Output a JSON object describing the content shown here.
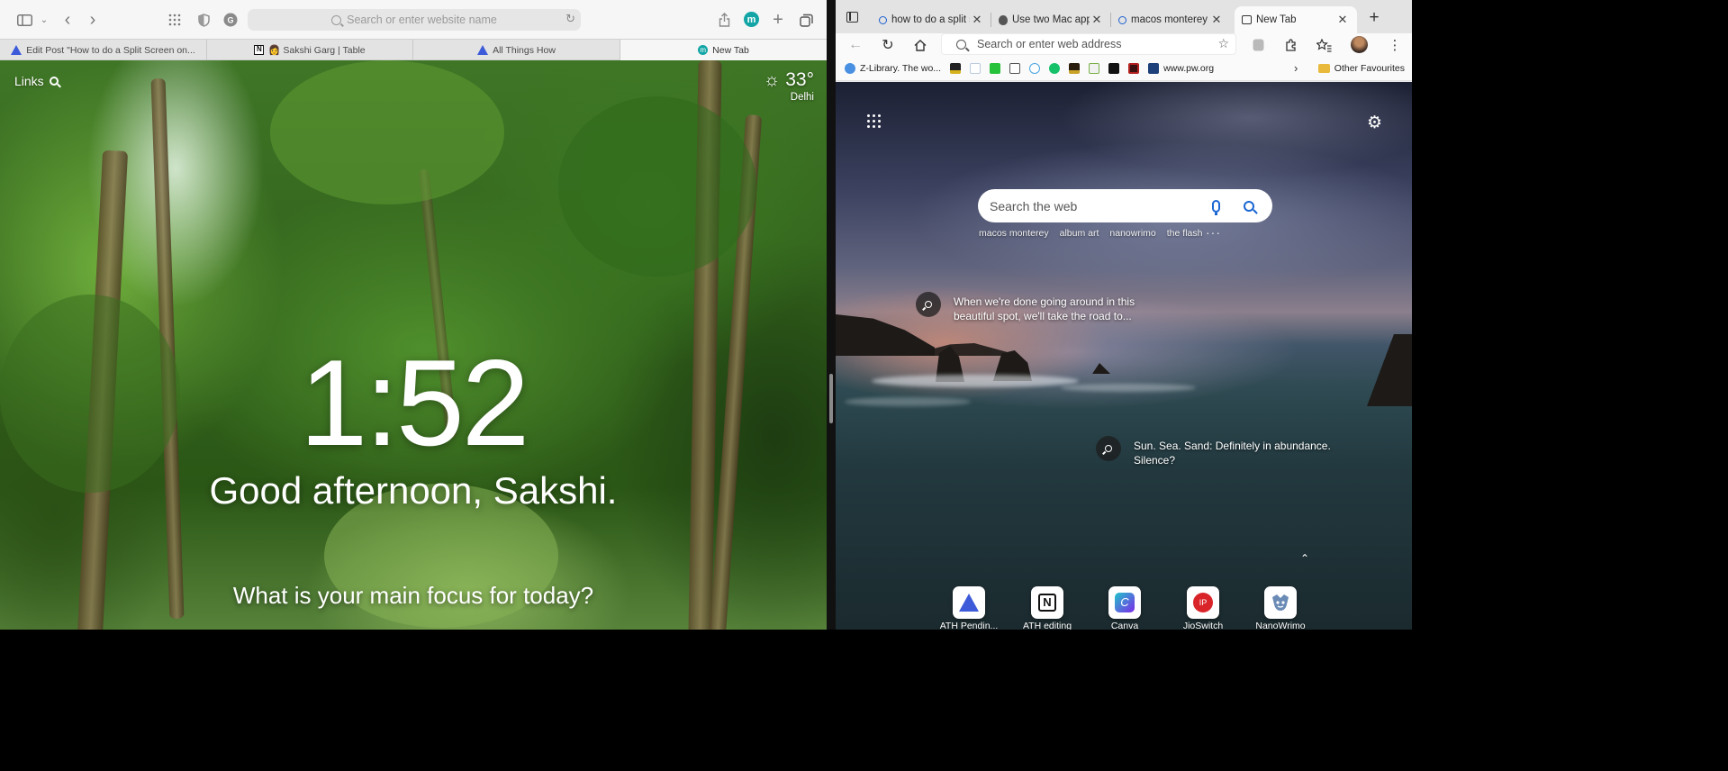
{
  "safari": {
    "toolbar": {
      "address_placeholder": "Search or enter website name",
      "avatar_letter": "m"
    },
    "tabs": [
      {
        "label": "Edit Post \"How to do a Split Screen on...",
        "favicon": "triangle-favicon"
      },
      {
        "label": "👩 Sakshi Garg | Table",
        "favicon": "notion-favicon"
      },
      {
        "label": "All Things How",
        "favicon": "triangle-favicon"
      },
      {
        "label": "New Tab",
        "favicon": "momentum-favicon"
      }
    ],
    "momentum": {
      "links_label": "Links",
      "temperature": "33°",
      "city": "Delhi",
      "time": "1:52",
      "greeting": "Good afternoon, Sakshi.",
      "focus_prompt": "What is your main focus for today?"
    }
  },
  "edge": {
    "tabs": [
      {
        "label": "how to do a split s",
        "favicon": "search-favicon"
      },
      {
        "label": "Use two Mac apps",
        "favicon": "apple-favicon"
      },
      {
        "label": "macos monterey",
        "favicon": "search-favicon"
      },
      {
        "label": "New Tab",
        "favicon": "newtab-favicon"
      }
    ],
    "address_placeholder": "Search or enter web address",
    "bookmarks": {
      "first_label": "Z-Library. The wo...",
      "last_label": "www.pw.org",
      "other_label": "Other Favourites"
    },
    "newtab": {
      "search_placeholder": "Search the web",
      "trending": [
        "macos monterey",
        "album art",
        "nanowrimo",
        "the flash"
      ],
      "more": "···",
      "hotspot_1": [
        "When we're done going around in this",
        "beautiful spot, we'll take the road to..."
      ],
      "hotspot_2": [
        "Sun. Sea. Sand: Definitely in abundance.",
        "Silence?"
      ],
      "quick_links": [
        {
          "label": "ATH Pendin...",
          "icon": "triangle-icon"
        },
        {
          "label": "ATH editing",
          "icon": "notion-icon"
        },
        {
          "label": "Canva",
          "icon": "canva-icon"
        },
        {
          "label": "JioSwitch",
          "icon": "jioswitch-icon"
        },
        {
          "label": "NanoWrimo",
          "icon": "nanowrimo-icon"
        }
      ]
    }
  }
}
